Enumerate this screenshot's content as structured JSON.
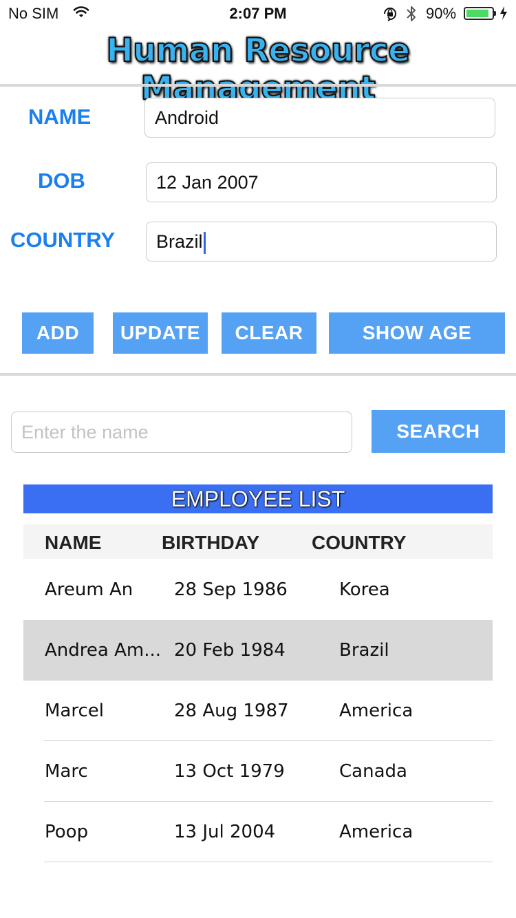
{
  "status_bar": {
    "carrier": "No SIM",
    "time": "2:07 PM",
    "battery": "90%",
    "battery_level": 0.9
  },
  "app": {
    "title": "Human Resource Management"
  },
  "form": {
    "name_label": "NAME",
    "name_value": "Android",
    "dob_label": "DOB",
    "dob_value": "12 Jan 2007",
    "country_label": "COUNTRY",
    "country_value": "Brazil"
  },
  "buttons": {
    "add": "ADD",
    "update": "UPDATE",
    "clear": "CLEAR",
    "show_age": "SHOW AGE"
  },
  "search": {
    "placeholder": "Enter the name",
    "button": "SEARCH"
  },
  "employee_list": {
    "title": "EMPLOYEE LIST",
    "headers": {
      "name": "NAME",
      "birthday": "BIRTHDAY",
      "country": "COUNTRY"
    },
    "rows": [
      {
        "name": "Areum An",
        "birthday": "28 Sep 1986",
        "country": "Korea"
      },
      {
        "name": "Andrea Am...",
        "birthday": "20 Feb 1984",
        "country": "Brazil"
      },
      {
        "name": "Marcel",
        "birthday": "28 Aug 1987",
        "country": "America"
      },
      {
        "name": "Marc",
        "birthday": "13 Oct 1979",
        "country": "Canada"
      },
      {
        "name": "Poop",
        "birthday": "13 Jul 2004",
        "country": "America"
      }
    ],
    "selected_row": 1
  },
  "colors": {
    "accent_label": "#1a7ff0",
    "button": "#55a2f4",
    "list_title_bg": "#3b6ff3",
    "selected_row_bg": "#d9d9d9"
  }
}
